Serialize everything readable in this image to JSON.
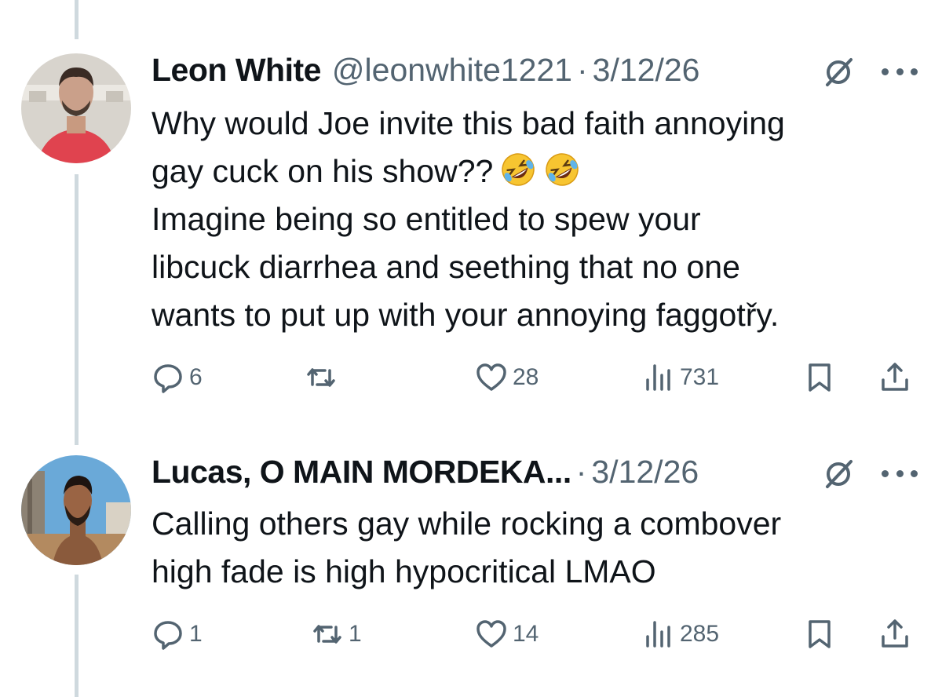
{
  "posts": [
    {
      "author_name": "Leon White",
      "handle": "@leonwhite1221",
      "separator": "·",
      "date": "3/12/26",
      "text_lines": [
        "Why would Joe invite this bad faith annoying",
        "gay cuck on his show??",
        "Imagine being so entitled to spew your",
        "libcuck diarrhea and seething that no one",
        "wants to put up with your annoying faggotřy."
      ],
      "emoji": [
        "rolling-on-floor-laughing-emoji",
        "rolling-on-floor-laughing-emoji"
      ],
      "stats": {
        "replies": "6",
        "reposts": "",
        "likes": "28",
        "views": "731"
      }
    },
    {
      "author_name": "Lucas, O MAIN MORDEKA...",
      "handle": "",
      "separator": "·",
      "date": "3/12/26",
      "text_lines": [
        "Calling others gay while rocking a combover",
        "high fade is high hypocritical LMAO"
      ],
      "stats": {
        "replies": "1",
        "reposts": "1",
        "likes": "14",
        "views": "285"
      }
    }
  ],
  "colors": {
    "text": "#0f1419",
    "secondary": "#536471",
    "thread_line": "#cfd9de"
  },
  "icons": [
    "reply-icon",
    "repost-icon",
    "like-icon",
    "views-icon",
    "bookmark-icon",
    "share-icon",
    "grok-icon",
    "more-icon"
  ]
}
